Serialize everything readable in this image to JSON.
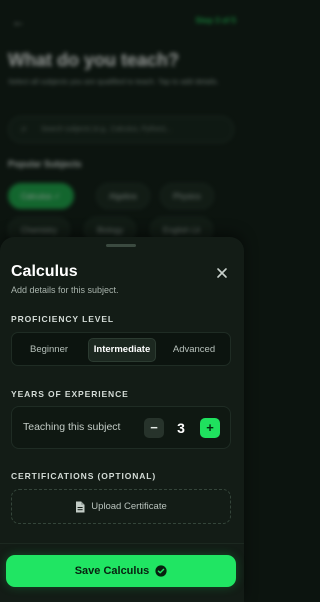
{
  "background": {
    "back_icon": "←",
    "step_text": "Step 3 of 5",
    "title": "What do you teach?",
    "subtitle": "Select all subjects you are qualified to teach. Tap to add details.",
    "search_placeholder": "Search subjects (e.g., Calculus, Python)...",
    "popular_label": "Popular Subjects",
    "chips": [
      "Calculus ✓",
      "Algebra",
      "Physics",
      "Chemistry",
      "Biology",
      "English Lit"
    ]
  },
  "sheet": {
    "title": "Calculus",
    "subtitle": "Add details for this subject.",
    "proficiency_label": "PROFICIENCY LEVEL",
    "proficiency_options": [
      "Beginner",
      "Intermediate",
      "Advanced"
    ],
    "proficiency_selected": "Intermediate",
    "years_label": "YEARS OF EXPERIENCE",
    "years_row_label": "Teaching this subject",
    "years_value": "3",
    "minus_symbol": "−",
    "plus_symbol": "+",
    "certifications_label": "CERTIFICATIONS (OPTIONAL)",
    "upload_label": "Upload Certificate",
    "save_label": "Save Calculus"
  },
  "colors": {
    "accent": "#20e563",
    "sheet_bg": "#131c16",
    "page_bg": "#0c140f"
  },
  "icons": {
    "close": "close-icon",
    "file": "file-icon",
    "check": "check-circle-icon"
  }
}
